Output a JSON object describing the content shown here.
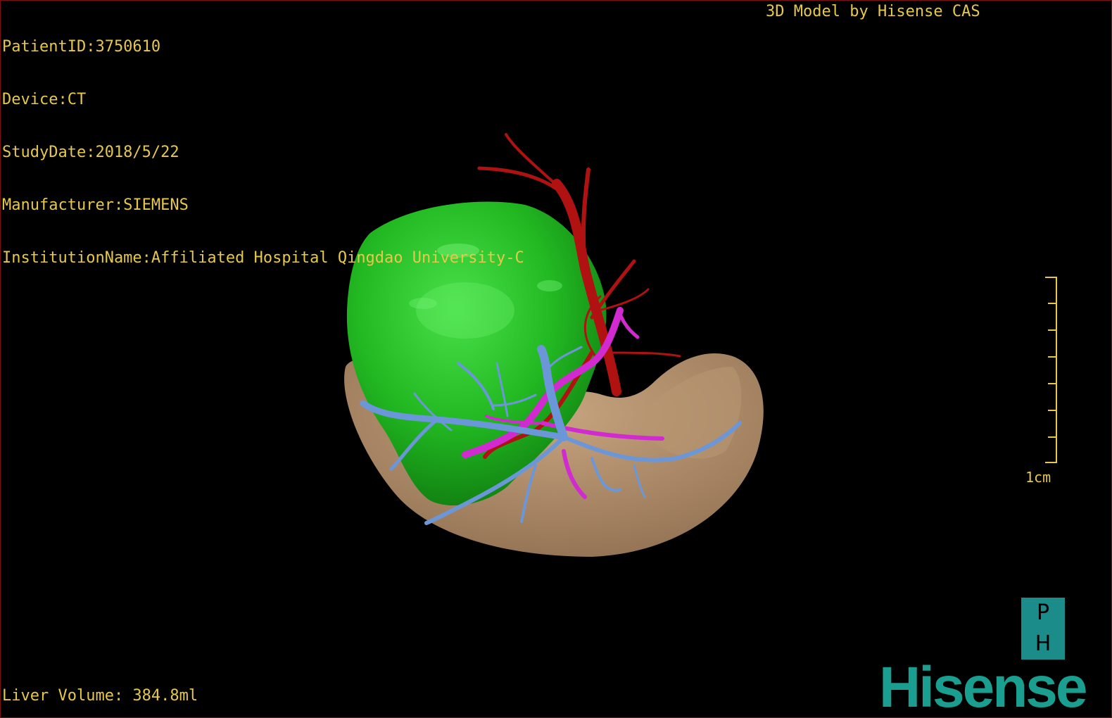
{
  "patient_info": {
    "patient_id": "PatientID:3750610",
    "device": "Device:CT",
    "study_date": "StudyDate:2018/5/22",
    "manufacturer": "Manufacturer:SIEMENS",
    "institution": "InstitutionName:Affiliated Hospital Qingdao University-C"
  },
  "model_credit": "3D Model by Hisense CAS",
  "liver_volume": "Liver Volume: 384.8ml",
  "scale": {
    "label": "1cm"
  },
  "orientation": {
    "top": "P",
    "bottom": "H"
  },
  "brand": "Hisense",
  "colors": {
    "overlay_text": "#e6c84a",
    "tumor": "#1fb41f",
    "liver": "#a88664",
    "artery": "#b01212",
    "portal_vein": "#d02ad0",
    "hepatic_vein": "#6b97d8",
    "brand": "#1a9e8f"
  }
}
